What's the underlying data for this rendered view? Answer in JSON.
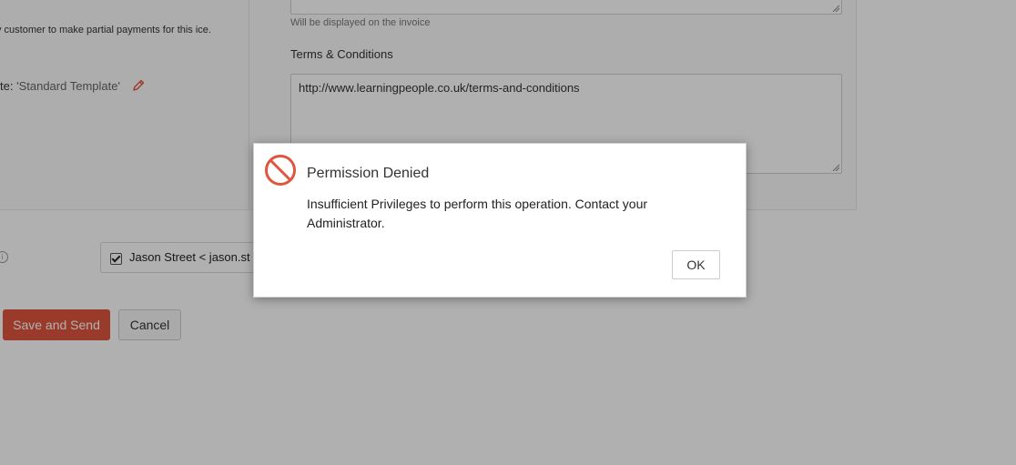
{
  "left_panel": {
    "partial_payment_text": "v customer to make partial payments for this ice.",
    "template_label": "te:",
    "template_name": "'Standard Template'"
  },
  "right_panel": {
    "notes_hint": "Will be displayed on the invoice",
    "terms_label": "Terms & Conditions",
    "terms_value": "http://www.learningpeople.co.uk/terms-and-conditions"
  },
  "contacts": {
    "info_icon": "info-icon",
    "contact_label": "Jason Street < jason.st",
    "checked": true
  },
  "actions": {
    "save_send_label": "Save and Send",
    "cancel_label": "Cancel",
    "save_color": "#e0553f"
  },
  "dialog": {
    "icon": "permission-denied-icon",
    "icon_color": "#e0553f",
    "title": "Permission Denied",
    "message": "Insufficient Privileges to perform this operation. Contact your Administrator.",
    "ok_label": "OK"
  }
}
